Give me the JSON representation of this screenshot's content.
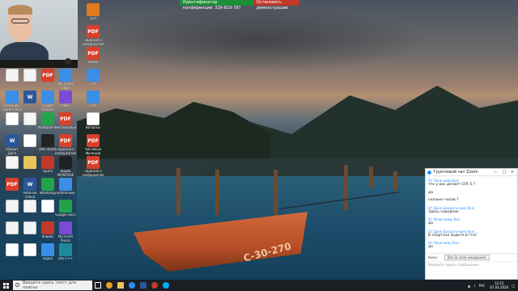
{
  "zoom_banner": {
    "left": "Идентификатор конференции: 326-819-787",
    "stop": "Остановить демонстрацию"
  },
  "desktop_icons": [
    {
      "label": "",
      "kind": "blank"
    },
    {
      "label": "Команды Zoom Cloud Meetings",
      "kind": "app"
    },
    {
      "label": "",
      "kind": "doc"
    },
    {
      "label": "Оборот Дисп Microsoft",
      "kind": "word"
    },
    {
      "label": "",
      "kind": "blank"
    },
    {
      "label": "",
      "kind": "pdf"
    },
    {
      "label": "",
      "kind": "blank"
    },
    {
      "label": "",
      "kind": "blank"
    },
    {
      "label": "",
      "kind": "doc"
    },
    {
      "label": "",
      "kind": "blank"
    },
    {
      "label": "",
      "kind": "word"
    },
    {
      "label": "",
      "kind": "blank"
    },
    {
      "label": "",
      "kind": "doc"
    },
    {
      "label": "",
      "kind": "folder"
    },
    {
      "label": "Рабочая папка",
      "kind": "word"
    },
    {
      "label": "",
      "kind": "blank"
    },
    {
      "label": "",
      "kind": "blank"
    },
    {
      "label": "",
      "kind": "doc"
    },
    {
      "label": "",
      "kind": "pdf"
    },
    {
      "label": "Google Chrome",
      "kind": "app"
    },
    {
      "label": "Notepad++",
      "kind": "green"
    },
    {
      "label": "OBS Studio",
      "kind": "dark"
    },
    {
      "label": "Opera",
      "kind": "red"
    },
    {
      "label": "WhatsApp",
      "kind": "green"
    },
    {
      "label": "",
      "kind": "doc"
    },
    {
      "label": "Яндекс",
      "kind": "red"
    },
    {
      "label": "Skype",
      "kind": "app"
    },
    {
      "label": "Microsoft Edge",
      "kind": "app"
    },
    {
      "label": "Viber",
      "kind": "purple"
    },
    {
      "label": "Беспарольный",
      "kind": "pdf"
    },
    {
      "label": "Задания к информатике",
      "kind": "pdf"
    },
    {
      "label": "Видео MONTAGE",
      "kind": "dark"
    },
    {
      "label": "TeamViewer",
      "kind": "app"
    },
    {
      "label": "Google Docs",
      "kind": "green"
    },
    {
      "label": "Microsoft Teams",
      "kind": "purple"
    },
    {
      "label": "Dev-C++",
      "kind": "teal"
    },
    {
      "label": "grid",
      "kind": "orange"
    },
    {
      "label": "Задания к информатике",
      "kind": "pdf"
    },
    {
      "label": "Выбор",
      "kind": "pdf"
    },
    {
      "label": "CPP",
      "kind": "app"
    },
    {
      "label": "CPP",
      "kind": "app"
    },
    {
      "label": "Вопросы",
      "kind": "doc"
    },
    {
      "label": "Числовые Функции",
      "kind": "pdf"
    },
    {
      "label": "Задания к информатике",
      "kind": "pdf"
    }
  ],
  "chat": {
    "title": "Групповой чат Zoom",
    "messages": [
      {
        "from": "От Паня кому Все:",
        "text": "что у вас делает GTA 5 ?"
      },
      {
        "from": "",
        "text": "да"
      },
      {
        "from": "",
        "text": "сколько часов ?"
      },
      {
        "from": "От Даня Бондуга кому Все:",
        "text": "Здесь наверное"
      },
      {
        "from": "От Юлия кому Все:",
        "text": "да"
      },
      {
        "from": "От Даня Бондуга кому Все:",
        "text": "В спортзал ходите в гта?"
      },
      {
        "from": "От Паня кому Все:",
        "text": "да"
      }
    ],
    "to_label": "Кому:",
    "to_value": "Все (в зале ожидания)",
    "input_placeholder": "Введите здесь сообщение..."
  },
  "taskbar": {
    "search_placeholder": "Введите здесь текст для поиска",
    "lang": "РУС",
    "time": "12:15",
    "date": "07.04.2020"
  },
  "boat_number": "С-30-270"
}
